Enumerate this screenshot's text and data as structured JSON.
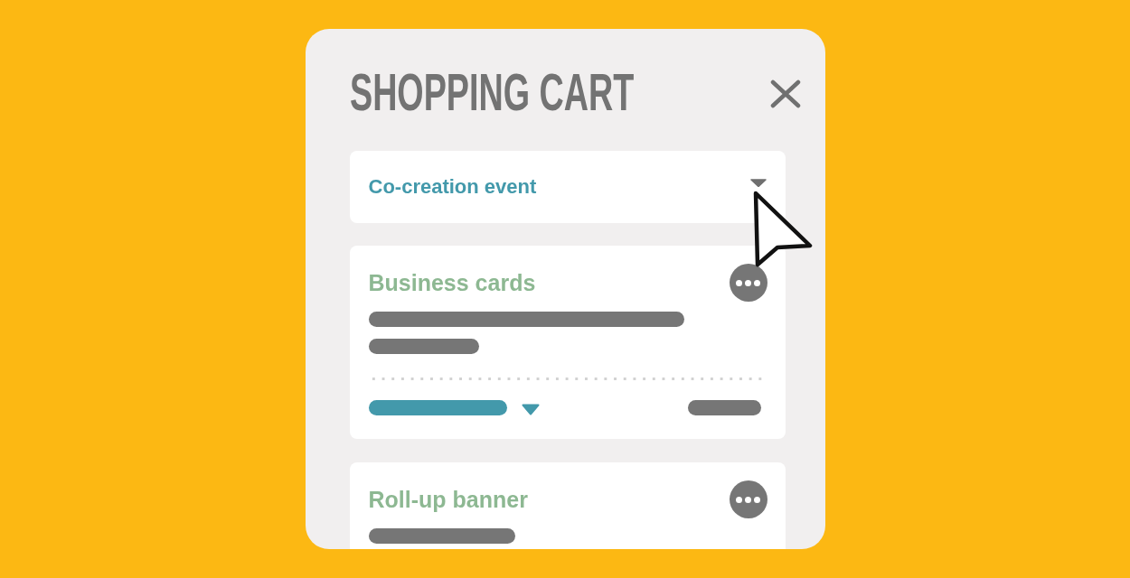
{
  "cart": {
    "title": "SHOPPING CART"
  },
  "section": {
    "title": "Co-creation event"
  },
  "items": [
    {
      "name": "Business cards",
      "kind": "detailed"
    },
    {
      "name": "Roll-up banner",
      "kind": "summary"
    }
  ]
}
